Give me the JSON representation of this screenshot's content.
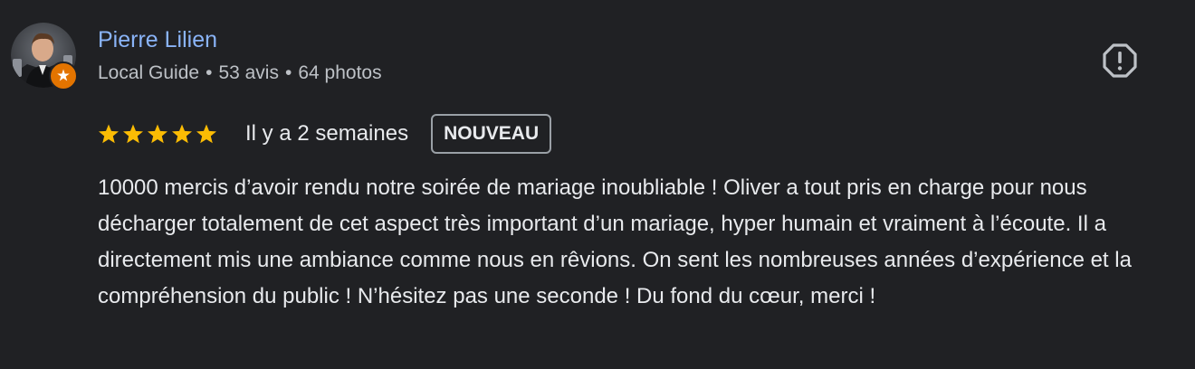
{
  "review": {
    "author": {
      "name": "Pierre Lilien",
      "role": "Local Guide",
      "reviews": "53 avis",
      "photos": "64 photos",
      "separator": "•"
    },
    "rating": 5,
    "date": "Il y a 2 semaines",
    "badge": "NOUVEAU",
    "text": "10000 mercis d’avoir rendu notre soirée de mariage inoubliable ! Oliver a tout pris en charge pour nous décharger totalement de cet aspect très important d’un mariage, hyper humain et vraiment à l’écoute. Il a directement mis une ambiance comme nous en rêvions. On sent les nombreuses années d’expérience et la compréhension du public ! N’hésitez pas une seconde ! Du fond du cœur, merci !"
  },
  "icons": {
    "report": "report-flag-icon",
    "star": "star-icon",
    "local_guide": "local-guide-badge-icon"
  },
  "colors": {
    "background": "#202124",
    "name_link": "#8ab4f8",
    "star": "#fbbc04",
    "badge_border": "#9aa0a6",
    "local_guide_badge": "#e37400"
  }
}
